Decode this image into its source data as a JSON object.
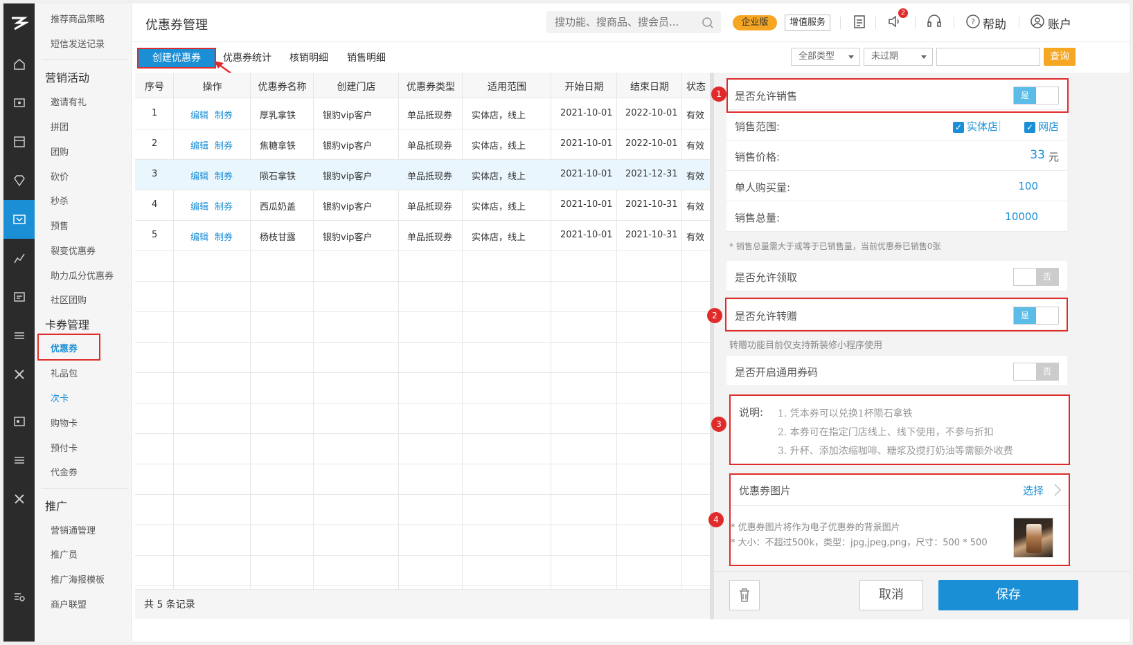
{
  "header": {
    "title": "优惠券管理",
    "search_placeholder": "搜功能、搜商品、搜会员...",
    "edition_badge": "企业版",
    "value_service": "增值服务",
    "notification_count": "2",
    "help": "帮助",
    "account": "账户"
  },
  "sidebar": {
    "items_top": [
      "推荐商品策略",
      "短信发送记录"
    ],
    "group_marketing": "营销活动",
    "marketing_items": [
      "邀请有礼",
      "拼团",
      "团购",
      "砍价",
      "秒杀",
      "预售",
      "裂变优惠券",
      "助力瓜分优惠券",
      "社区团购"
    ],
    "group_cards": "卡券管理",
    "card_items": [
      "优惠券",
      "礼品包",
      "次卡",
      "购物卡",
      "预付卡",
      "代金券"
    ],
    "group_promo": "推广",
    "promo_items": [
      "营销通管理",
      "推广员",
      "推广海报模板",
      "商户联盟"
    ]
  },
  "tabs": [
    "创建优惠券",
    "优惠券统计",
    "核销明细",
    "销售明细"
  ],
  "filters": {
    "type": "全部类型",
    "status": "未过期",
    "search_value": "",
    "query_button": "查询"
  },
  "table": {
    "headers": [
      "序号",
      "操作",
      "优惠券名称",
      "创建门店",
      "优惠券类型",
      "适用范围",
      "开始日期",
      "结束日期",
      "状态"
    ],
    "rows": [
      {
        "no": "1",
        "edit": "编辑",
        "make": "制券",
        "name": "厚乳拿铁",
        "store": "银豹vip客户",
        "type": "单品抵现券",
        "scope": "实体店，线上",
        "start": "2021-10-01",
        "end": "2022-10-01",
        "status": "有效"
      },
      {
        "no": "2",
        "edit": "编辑",
        "make": "制券",
        "name": "焦糖拿铁",
        "store": "银豹vip客户",
        "type": "单品抵现券",
        "scope": "实体店，线上",
        "start": "2021-10-01",
        "end": "2022-10-01",
        "status": "有效"
      },
      {
        "no": "3",
        "edit": "编辑",
        "make": "制券",
        "name": "陨石拿铁",
        "store": "银豹vip客户",
        "type": "单品抵现券",
        "scope": "实体店，线上",
        "start": "2021-10-01",
        "end": "2021-12-31",
        "status": "有效"
      },
      {
        "no": "4",
        "edit": "编辑",
        "make": "制券",
        "name": "西瓜奶盖",
        "store": "银豹vip客户",
        "type": "单品抵现券",
        "scope": "实体店，线上",
        "start": "2021-10-01",
        "end": "2021-10-31",
        "status": "有效"
      },
      {
        "no": "5",
        "edit": "编辑",
        "make": "制券",
        "name": "杨枝甘露",
        "store": "银豹vip客户",
        "type": "单品抵现券",
        "scope": "实体店，线上",
        "start": "2021-10-01",
        "end": "2021-10-31",
        "status": "有效"
      }
    ],
    "total": "共 5 条记录"
  },
  "panel": {
    "allow_sale": "是否允许销售",
    "yes": "是",
    "no": "否",
    "sale_scope_label": "销售范围:",
    "scope_store": "实体店",
    "scope_online": "网店",
    "price_label": "销售价格:",
    "price_value": "33",
    "price_unit": "元",
    "per_person_label": "单人购买量:",
    "per_person_value": "100",
    "total_label": "销售总量:",
    "total_value": "10000",
    "total_note": "* 销售总量需大于或等于已销售量，当前优惠券已销售0张",
    "allow_receive": "是否允许领取",
    "allow_transfer": "是否允许转赠",
    "transfer_note": "转赠功能目前仅支持新装修小程序使用",
    "universal_code": "是否开启通用券码",
    "desc_label": "说明:",
    "desc_lines": [
      "1. 凭本券可以兑换1杯陨石拿铁",
      "2. 本券可在指定门店线上、线下使用，不参与折扣",
      "3. 升杯、添加浓缩咖啡、糖浆及搅打奶油等需额外收费"
    ],
    "image_label": "优惠券图片",
    "image_select": "选择",
    "image_note1": "* 优惠券图片将作为电子优惠券的背景图片",
    "image_note2": "* 大小：不超过500k，类型：jpg,jpeg,png，尺寸：500 * 500",
    "cancel": "取消",
    "save": "保存"
  },
  "annotations": [
    "1",
    "2",
    "3",
    "4"
  ]
}
